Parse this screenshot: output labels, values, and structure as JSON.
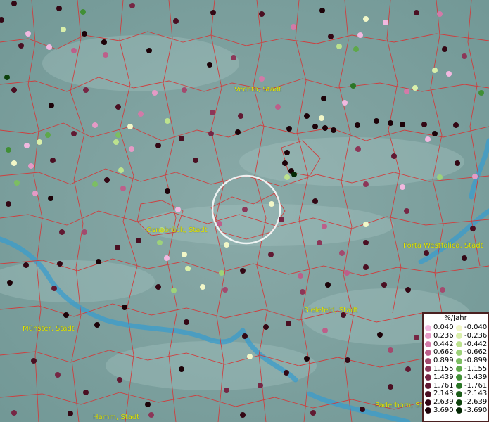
{
  "map": {
    "cities": [
      {
        "name": "Vechta, Stadt"
      },
      {
        "name": "Osnabrück, Stadt"
      },
      {
        "name": "Porta Westfalica, Stadt"
      },
      {
        "name": "Bielefeld, Stadt"
      },
      {
        "name": "Münster, Stadt"
      },
      {
        "name": "Paderborn, St"
      },
      {
        "name": "Hamm, Stadt"
      }
    ]
  },
  "legend": {
    "title": "%/Jahr",
    "rows": [
      {
        "pos": "0.040",
        "neg": "-0.040",
        "pos_color": "#f2b8e0",
        "neg_color": "#f2f7c8"
      },
      {
        "pos": "0.236",
        "neg": "-0.236",
        "pos_color": "#e59ac6",
        "neg_color": "#d9efaa"
      },
      {
        "pos": "0.442",
        "neg": "-0.442",
        "pos_color": "#d27aa8",
        "neg_color": "#bce28e"
      },
      {
        "pos": "0.662",
        "neg": "-0.662",
        "pos_color": "#bd5f8a",
        "neg_color": "#9dd27a"
      },
      {
        "pos": "0.899",
        "neg": "-0.899",
        "pos_color": "#a34a6e",
        "neg_color": "#7cbe62"
      },
      {
        "pos": "1.155",
        "neg": "-1.155",
        "pos_color": "#8c3658",
        "neg_color": "#5ea84a"
      },
      {
        "pos": "1.439",
        "neg": "-1.439",
        "pos_color": "#762644",
        "neg_color": "#418f36"
      },
      {
        "pos": "1.761",
        "neg": "-1.761",
        "pos_color": "#611932",
        "neg_color": "#2b7626"
      },
      {
        "pos": "2.143",
        "neg": "-2.143",
        "pos_color": "#4a0f22",
        "neg_color": "#1a5c18"
      },
      {
        "pos": "2.639",
        "neg": "-2.639",
        "pos_color": "#330714",
        "neg_color": "#0d420c"
      },
      {
        "pos": "3.690",
        "neg": "-3.690",
        "pos_color": "#1c0208",
        "neg_color": "#042804"
      }
    ]
  }
}
